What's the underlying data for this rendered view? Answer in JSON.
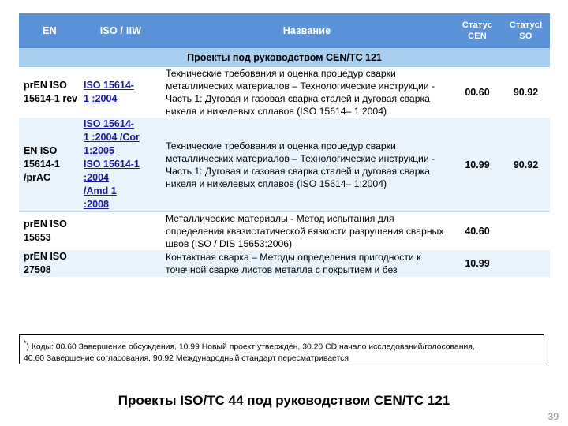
{
  "table": {
    "headers": {
      "en": "EN",
      "iso_iiw": "ISO / IIW",
      "name": "Название",
      "status_cen_line1": "Статус",
      "status_cen_line2": "CEN",
      "status_iso_line1": "СтатусI",
      "status_iso_line2": "SO"
    },
    "section_title": "Проекты под руководством CEN/TC 121",
    "rows": [
      {
        "en": "prEN ISO 15614-1 rev",
        "iso_lines": [
          "ISO  15614-",
          "1 :2004"
        ],
        "name": "Технические требования и оценка процедур сварки металлических материалов – Технологические инструкции - Часть 1: Дуговая и газовая сварка сталей и дуговая сварка никеля и никелевых сплавов (ISO 15614– 1:2004)",
        "status_cen": "00.60",
        "status_iso": "90.92"
      },
      {
        "en": "EN ISO 15614-1 /prAC",
        "iso_lines": [
          "ISO  15614-",
          "1 :2004 /Cor",
          "1:2005",
          "ISO 15614-1",
          ":2004",
          "/Amd 1",
          ":2008"
        ],
        "name": "Технические требования и оценка процедур сварки металлических материалов – Технологические инструкции - Часть 1: Дуговая и газовая сварка сталей и дуговая сварка никеля и никелевых сплавов (ISO 15614– 1:2004)",
        "status_cen": "10.99",
        "status_iso": "90.92"
      },
      {
        "en": "prEN ISO 15653",
        "iso_lines": [],
        "name": "Металлические материалы - Метод испытания для определения квазистатической вязкости разрушения сварных швов (ISO / DIS 15653:2006)",
        "status_cen": "40.60",
        "status_iso": ""
      },
      {
        "en": "prEN ISO 27508",
        "iso_lines": [],
        "name": "Контактная сварка – Методы определения пригодности к точечной сварке листов металла с покрытием и без",
        "status_cen": "10.99",
        "status_iso": ""
      }
    ]
  },
  "footnote": {
    "marker": "*",
    "line1": ") Коды: 00.60 Завершение обсуждения, 10.99 Новый проект утверждён, 30.20 CD начало исследований/голосования,",
    "line2": "40.60 Завершение согласования,  90.92 Международный стандарт пересматривается"
  },
  "caption": "Проекты ISO/TC 44 под руководством CEN/TC 121",
  "page_number": "39",
  "colors": {
    "header_blue": "#5b92d8",
    "subheader_blue": "#a8cef0",
    "row_tint": "#e8f3fc",
    "link_blue": "#1a1a9c"
  }
}
